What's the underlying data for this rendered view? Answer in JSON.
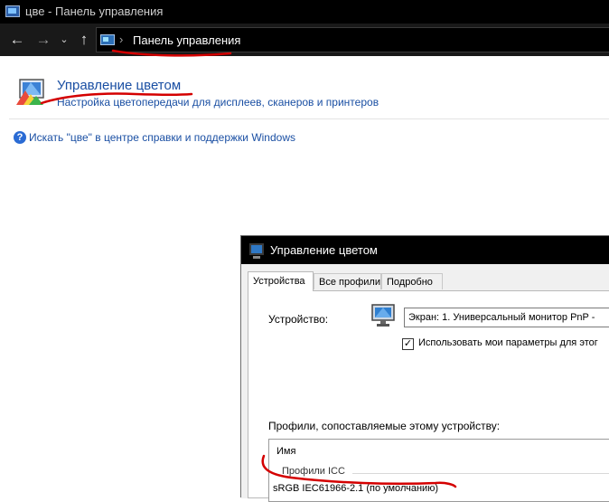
{
  "window": {
    "title": "цве - Панель управления"
  },
  "nav": {
    "back_symbol": "←",
    "forward_symbol": "→",
    "recent_symbol": "⌄",
    "up_symbol": "↑",
    "breadcrumb_separator": "›",
    "breadcrumb": "Панель управления"
  },
  "result": {
    "title": "Управление цветом",
    "subtitle": "Настройка цветопередачи для дисплеев, сканеров и принтеров"
  },
  "help": {
    "icon_glyph": "?",
    "link_text": "Искать \"цве\" в центре справки и поддержки Windows"
  },
  "dialog": {
    "title": "Управление цветом",
    "tabs": [
      {
        "label": "Устройства",
        "active": true
      },
      {
        "label": "Все профили",
        "active": false
      },
      {
        "label": "Подробно",
        "active": false
      }
    ],
    "device_label": "Устройство:",
    "device_value": "Экран: 1. Универсальный монитор PnP -",
    "use_settings_label": "Использовать мои параметры для этог",
    "use_settings_checked": true,
    "check_glyph": "✓",
    "profiles_label": "Профили, сопоставляемые этому устройству:",
    "list_header": "Имя",
    "group_label": "Профили ICC",
    "profiles": [
      "sRGB IEC61966-2.1 (по умолчанию)"
    ]
  },
  "colors": {
    "title_bar": "#000000",
    "link_blue": "#1a4fa3",
    "annotation_red": "#d40000"
  }
}
